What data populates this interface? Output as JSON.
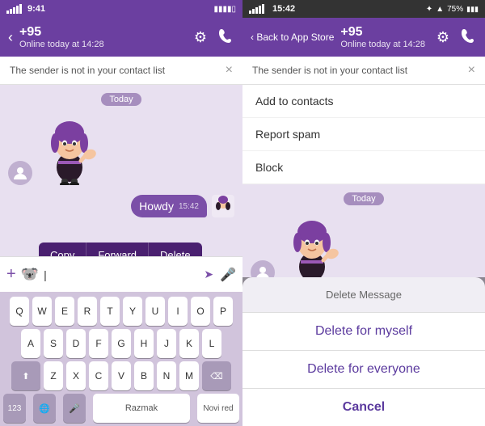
{
  "left": {
    "statusBar": {
      "carrier": "●●●●●●",
      "time": "9:41",
      "batteryIcon": "▮▮▮▮"
    },
    "header": {
      "backLabel": "‹",
      "contactName": "+95",
      "statusText": "Online today at 14:28",
      "settingsIcon": "⚙",
      "callIcon": "📞"
    },
    "warningText": "The sender is not in your contact list",
    "dateBadge": "Today",
    "contextMenu": {
      "copy": "Copy",
      "forward": "Forward",
      "delete": "Delete"
    },
    "sentMessage": {
      "text": "Howdy",
      "time": "15:42"
    },
    "inputPlaceholder": "|",
    "keyboard": {
      "row1": [
        "Q",
        "W",
        "E",
        "R",
        "T",
        "Y",
        "U",
        "I",
        "O",
        "P"
      ],
      "row2": [
        "A",
        "S",
        "D",
        "F",
        "G",
        "H",
        "J",
        "K",
        "L"
      ],
      "row3": [
        "Z",
        "X",
        "C",
        "V",
        "B",
        "N",
        "M"
      ],
      "spaceLabel": "Razmak",
      "noviRed": "Novi red"
    }
  },
  "right": {
    "statusBar": {
      "time": "15:42",
      "bluetooth": "✦",
      "wifi": "▲",
      "battery": "75%"
    },
    "header": {
      "backLabel": "‹ Back to App Store",
      "contactName": "+95",
      "statusText": "Online today at 14:28"
    },
    "warningText": "The sender is not in your contact list",
    "dropdownItems": [
      "Add to contacts",
      "Report spam",
      "Block"
    ],
    "dateBadge": "Today",
    "deleteDialog": {
      "title": "Delete Message",
      "option1": "Delete for myself",
      "option2": "Delete for everyone",
      "cancel": "Cancel"
    }
  }
}
